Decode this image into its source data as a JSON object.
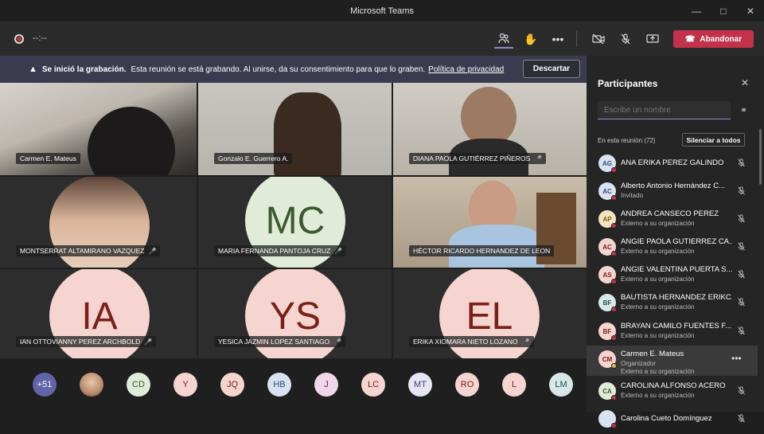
{
  "window": {
    "title": "Microsoft Teams"
  },
  "toolbar": {
    "timer": "--:--",
    "leave_label": "Abandonar"
  },
  "banner": {
    "bold": "Se inició la grabación.",
    "text": "Esta reunión se está grabando. Al unirse, da su consentimiento para que lo graben.",
    "link": "Política de privacidad",
    "dismiss": "Descartar"
  },
  "tiles": [
    {
      "name": "Carmen E. Mateus"
    },
    {
      "name": "Gonzalo E. Guerrero A."
    },
    {
      "name": "DIANA PAOLA GUTIÉRREZ PIÑEROS"
    },
    {
      "name": "MONTSERRAT ALTAMIRANO VAZQUEZ"
    },
    {
      "name": "MARIA FERNANDA PANTOJA CRUZ",
      "initials": "MC",
      "color": "#e0ecd8",
      "text_color": "#3b5a2e"
    },
    {
      "name": "HÉCTOR RICARDO HERNANDEZ DE LEON"
    },
    {
      "name": "IAN OTTOVIANNY PEREZ ARCHBOLD",
      "initials": "IA",
      "color": "#f6d4d0",
      "text_color": "#7a2018"
    },
    {
      "name": "YESICA JAZMIN LOPEZ SANTIAGO",
      "initials": "YS",
      "color": "#f6d4d0",
      "text_color": "#7a2018"
    },
    {
      "name": "ERIKA XIOMARA NIETO LOZANO",
      "initials": "EL",
      "color": "#f6d4d0",
      "text_color": "#7a2018"
    }
  ],
  "overflow": [
    {
      "label": "+51",
      "bg": "#6264a7",
      "fg": "#ffffff"
    },
    {
      "label": "",
      "bg": "#d9b59a",
      "fg": "#000000"
    },
    {
      "label": "CD",
      "bg": "#e0ecd8",
      "fg": "#3b5a2e"
    },
    {
      "label": "Y",
      "bg": "#f6d4d0",
      "fg": "#7a2018"
    },
    {
      "label": "JQ",
      "bg": "#f6d4d0",
      "fg": "#7a2018"
    },
    {
      "label": "HB",
      "bg": "#d8e2f0",
      "fg": "#2b4a78"
    },
    {
      "label": "J",
      "bg": "#f0d8ec",
      "fg": "#6a2060"
    },
    {
      "label": "LC",
      "bg": "#f6d4d0",
      "fg": "#7a2018"
    },
    {
      "label": "MT",
      "bg": "#e6e6f5",
      "fg": "#3b3b6a"
    },
    {
      "label": "RO",
      "bg": "#f6d4d0",
      "fg": "#7a2018"
    },
    {
      "label": "L",
      "bg": "#f6d4d0",
      "fg": "#7a2018"
    },
    {
      "label": "LM",
      "bg": "#d8e8e8",
      "fg": "#205050"
    }
  ],
  "panel": {
    "title": "Participantes",
    "search_placeholder": "Escribe un nombre",
    "in_meeting": "En esta reunión (72)",
    "mute_all": "Silenciar a todos",
    "participants": [
      {
        "initials": "AG",
        "name": "ANA ERIKA PEREZ GALINDO",
        "sub": "",
        "bg": "#d8e2f0",
        "fg": "#2b4a78"
      },
      {
        "initials": "AC",
        "name": "Alberto Antonio Hernández C...",
        "sub": "Invitado",
        "bg": "#d8e2f0",
        "fg": "#2b4a78"
      },
      {
        "initials": "AP",
        "name": "ANDREA CANSECO PEREZ",
        "sub": "Externo a su organización",
        "bg": "#f7e3c0",
        "fg": "#7a5a10"
      },
      {
        "initials": "AC",
        "name": "ANGIE PAOLA GUTIERREZ CA...",
        "sub": "Externo a su organización",
        "bg": "#f6d4d0",
        "fg": "#7a2018"
      },
      {
        "initials": "AS",
        "name": "ANGIE VALENTINA PUERTA S...",
        "sub": "Externo a su organización",
        "bg": "#f6d4d0",
        "fg": "#7a2018"
      },
      {
        "initials": "BF",
        "name": "BAUTISTA HERNANDEZ ERIKC...",
        "sub": "Externo a su organización",
        "bg": "#d8e8e8",
        "fg": "#205050"
      },
      {
        "initials": "BF",
        "name": "BRAYAN CAMILO FUENTES F...",
        "sub": "Externo a su organización",
        "bg": "#f6d4d0",
        "fg": "#7a2018"
      },
      {
        "initials": "CM",
        "name": "Carmen E. Mateus",
        "sub": "Organizador",
        "sub2": "Externo a su organización",
        "bg": "#f6d4d0",
        "fg": "#7a2018"
      },
      {
        "initials": "CA",
        "name": "CAROLINA ALFONSO ACERO",
        "sub": "Externo a su organización",
        "bg": "#e0ecd8",
        "fg": "#3b5a2e"
      },
      {
        "initials": "",
        "name": "Carolina Cueto Domínguez",
        "sub": "",
        "bg": "#d8e2f0",
        "fg": "#2b4a78"
      }
    ]
  }
}
